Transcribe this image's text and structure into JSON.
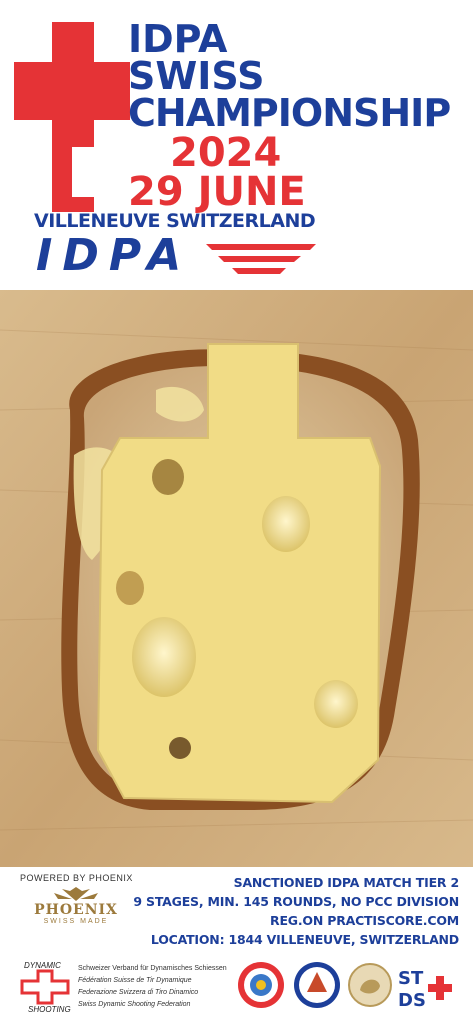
{
  "header": {
    "title_line1": "IDPA",
    "title_line2": "SWISS",
    "title_line3": "CHAMPIONSHIP",
    "year": "2024",
    "date": "29 JUNE",
    "location": "VILLENEUVE SWITZERLAND",
    "logo_text": "IDPA"
  },
  "footer": {
    "powered_by": "POWERED BY PHOENIX",
    "phoenix_name": "PHOENIX",
    "phoenix_tagline": "SWISS MADE",
    "info_lines": [
      "SANCTIONED IDPA MATCH TIER 2",
      "9 STAGES, MIN. 145 ROUNDS, NO PCC DIVISION",
      "REG.ON PRACTISCORE.COM",
      "LOCATION: 1844 VILLENEUVE, SWITZERLAND"
    ],
    "federation_logo_top": "DYNAMIC",
    "federation_logo_bottom": "SHOOTING",
    "federation_names": [
      "Schweizer Verband für Dynamisches Schiessen",
      "Fédération Suisse de Tir Dynamique",
      "Federazione Svizzera di Tiro Dinamico",
      "Swiss Dynamic Shooting Federation"
    ],
    "sponsor_badges": [
      "badge-1",
      "badge-2",
      "badge-3",
      "STDS"
    ]
  },
  "colors": {
    "brand_blue": "#1d3f9a",
    "brand_red": "#e53336",
    "cheese": "#f1dc86",
    "bread_crust": "#8a4f22",
    "board": "#d9b98c"
  }
}
